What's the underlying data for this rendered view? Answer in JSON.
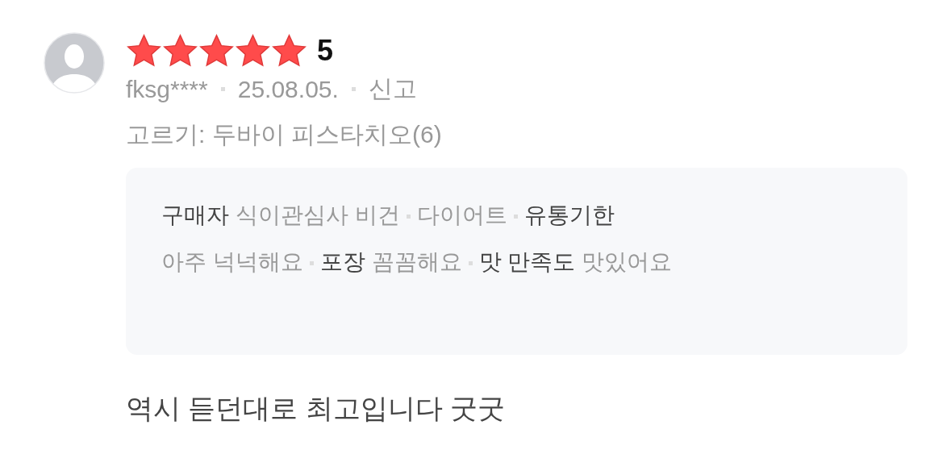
{
  "review": {
    "stars": 5,
    "score": "5",
    "user": "fksg****",
    "date": "25.08.05.",
    "report": "신고",
    "option": "고르기: 두바이 피스타치오(6)",
    "attributes": [
      {
        "label": "구매자",
        "values": [
          "식이관심사 비건",
          "다이어트"
        ]
      },
      {
        "label": "유통기한",
        "values": [
          "아주 넉넉해요"
        ]
      },
      {
        "label": "포장",
        "values": [
          "꼼꼼해요"
        ]
      },
      {
        "label": "맛 만족도",
        "values": [
          "맛있어요"
        ]
      }
    ],
    "text": "역시 듣던대로 최고입니다 굿굿"
  }
}
